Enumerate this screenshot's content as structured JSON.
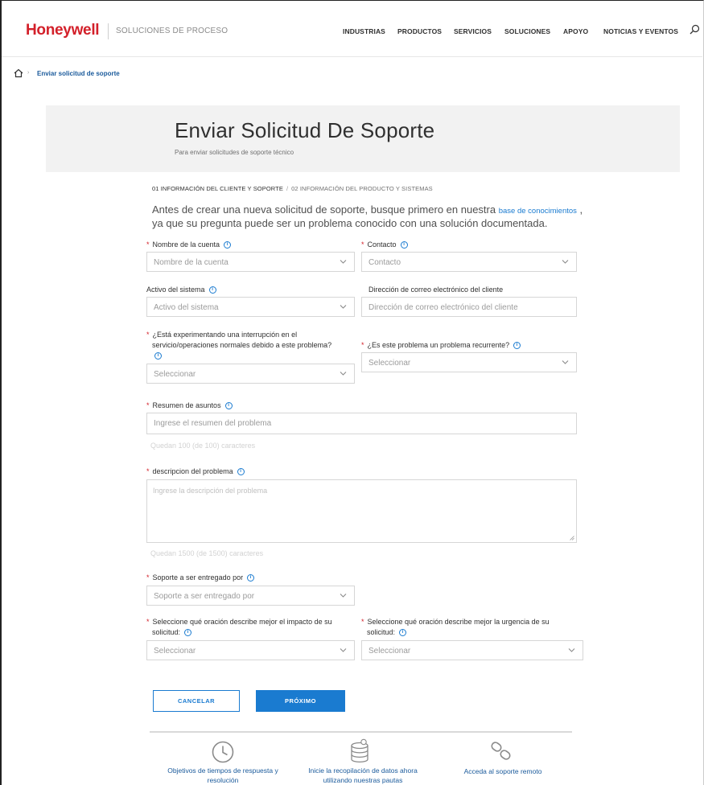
{
  "header": {
    "logo": "Honeywell",
    "tagline": "SOLUCIONES DE PROCESO",
    "nav": [
      "INDUSTRIAS",
      "PRODUCTOS",
      "SERVICIOS",
      "SOLUCIONES",
      "APOYO",
      "NOTICIAS Y EVENTOS"
    ]
  },
  "breadcrumb": {
    "current": "Enviar solicitud de soporte"
  },
  "hero": {
    "title": "Enviar Solicitud De Soporte",
    "subtitle": "Para enviar solicitudes de soporte técnico"
  },
  "steps": {
    "step1": "01 INFORMACIÓN DEL CLIENTE Y SOPORTE",
    "separator": "/",
    "step2": "02 INFORMACIÓN DEL PRODUCTO Y SISTEMAS"
  },
  "intro": {
    "text_before": "Antes de crear una nueva solicitud de soporte, busque primero en nuestra",
    "link": "base de conocimientos",
    "text_mid": ",",
    "text_after": "ya que su pregunta puede ser un problema conocido con una solución documentada."
  },
  "form": {
    "account": {
      "label": "Nombre de la cuenta",
      "placeholder": "Nombre de la cuenta"
    },
    "contact": {
      "label": "Contacto",
      "placeholder": "Contacto"
    },
    "asset": {
      "label": "Activo del sistema",
      "placeholder": "Activo del sistema"
    },
    "email": {
      "label": "Dirección de correo electrónico del cliente",
      "placeholder": "Dirección de correo electrónico del cliente"
    },
    "interruption": {
      "label_line1": "¿Está experimentando una interrupción en el",
      "label_line2": "servicio/operaciones normales debido a este problema?",
      "placeholder": "Seleccionar"
    },
    "recurrent": {
      "label": "¿Es este problema un problema recurrente?",
      "placeholder": "Seleccionar"
    },
    "summary": {
      "label": "Resumen de asuntos",
      "placeholder": "Ingrese el resumen del problema",
      "counter": "Quedan 100 (de 100) caracteres"
    },
    "description": {
      "label": "descripcion del problema",
      "placeholder": "Ingrese la descripción del problema",
      "counter": "Quedan 1500 (de 1500) caracteres"
    },
    "support_by": {
      "label": "Soporte a ser entregado por",
      "placeholder": "Soporte a ser entregado por"
    },
    "impact": {
      "label_line1": "Seleccione qué oración describe mejor el impacto de su",
      "label_line2": "solicitud:",
      "placeholder": "Seleccionar"
    },
    "urgency": {
      "label_line1": "Seleccione qué oración describe mejor la urgencia de su",
      "label_line2": "solicitud:",
      "placeholder": "Seleccionar"
    },
    "required_mark": "*",
    "info_glyph": "i"
  },
  "buttons": {
    "cancel": "CANCELAR",
    "next": "PRÓXIMO"
  },
  "footer": {
    "item1_line1": "Objetivos de tiempos de respuesta y",
    "item1_line2": "resolución",
    "item2_line1": "Inicie la recopilación de datos ahora",
    "item2_line2": "utilizando nuestras pautas",
    "item3": "Acceda al soporte remoto"
  },
  "colors": {
    "brand_red": "#d3202a",
    "accent_blue": "#1a7bd0",
    "link_blue": "#1a5a9b",
    "hero_bg": "#f2f2f2"
  }
}
